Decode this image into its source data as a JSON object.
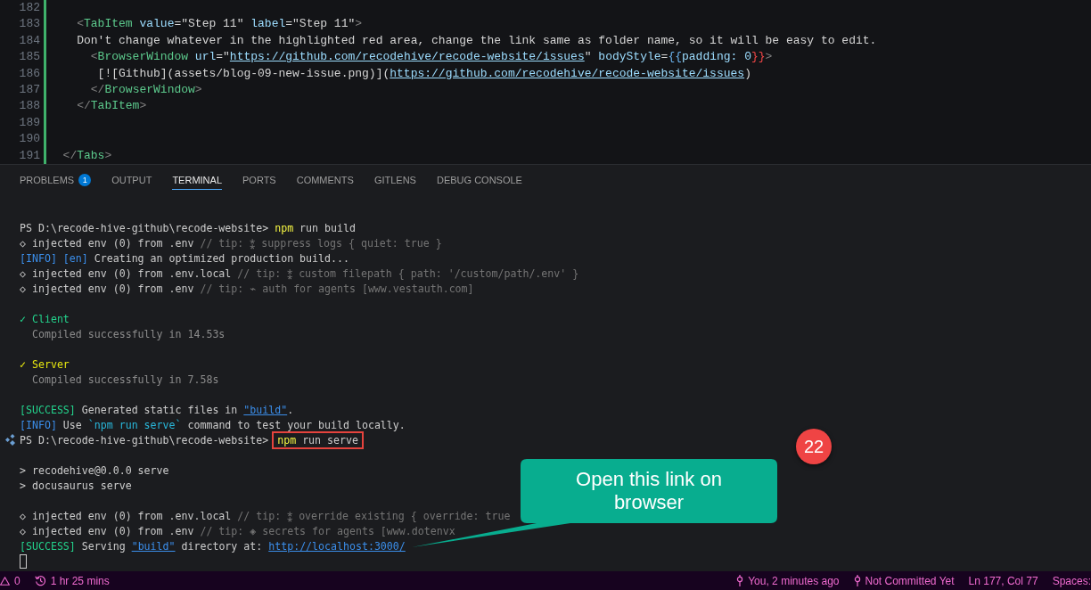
{
  "editor": {
    "lines": [
      {
        "number": "182",
        "changed": true
      },
      {
        "number": "183",
        "changed": true,
        "tokens": [
          {
            "text": "    <",
            "kind": "punct"
          },
          {
            "text": "TabItem",
            "kind": "tag"
          },
          {
            "text": " value",
            "kind": "attr"
          },
          {
            "text": "=\"Step 11\"",
            "kind": "text"
          },
          {
            "text": " label",
            "kind": "attr"
          },
          {
            "text": "=\"Step 11\"",
            "kind": "text"
          },
          {
            "text": ">",
            "kind": "punct"
          }
        ]
      },
      {
        "number": "184",
        "changed": true,
        "tokens": [
          {
            "text": "    Don't change whatever in the highlighted red area, change the link same as folder name, so it will be easy to edit.",
            "kind": "text"
          }
        ]
      },
      {
        "number": "185",
        "changed": true,
        "tokens": [
          {
            "text": "      <",
            "kind": "punct"
          },
          {
            "text": "BrowserWindow",
            "kind": "tag"
          },
          {
            "text": " url",
            "kind": "attr"
          },
          {
            "text": "=\"",
            "kind": "text"
          },
          {
            "text": "https://github.com/recodehive/recode-website/issues",
            "kind": "link"
          },
          {
            "text": "\"",
            "kind": "text"
          },
          {
            "text": " bodyStyle",
            "kind": "attr"
          },
          {
            "text": "=",
            "kind": "text"
          },
          {
            "text": "{{",
            "kind": "brace"
          },
          {
            "text": "padding: 0",
            "kind": "attr"
          },
          {
            "text": "}}",
            "kind": "error"
          },
          {
            "text": ">",
            "kind": "punct"
          }
        ]
      },
      {
        "number": "186",
        "changed": true,
        "tokens": [
          {
            "text": "       [![Github](assets/blog-09-new-issue.png)](",
            "kind": "text"
          },
          {
            "text": "https://github.com/recodehive/recode-website/issues",
            "kind": "link"
          },
          {
            "text": ")",
            "kind": "text"
          }
        ]
      },
      {
        "number": "187",
        "changed": true,
        "tokens": [
          {
            "text": "      </",
            "kind": "punct"
          },
          {
            "text": "BrowserWindow",
            "kind": "tag"
          },
          {
            "text": ">",
            "kind": "punct"
          }
        ]
      },
      {
        "number": "188",
        "changed": true,
        "tokens": [
          {
            "text": "    </",
            "kind": "punct"
          },
          {
            "text": "TabItem",
            "kind": "tag"
          },
          {
            "text": ">",
            "kind": "punct"
          }
        ]
      },
      {
        "number": "189",
        "changed": true
      },
      {
        "number": "190",
        "changed": true
      },
      {
        "number": "191",
        "changed": true,
        "tokens": [
          {
            "text": "  </",
            "kind": "punct"
          },
          {
            "text": "Tabs",
            "kind": "tag"
          },
          {
            "text": ">",
            "kind": "punct"
          }
        ]
      }
    ]
  },
  "panel": {
    "tabs": [
      {
        "label": "PROBLEMS",
        "selected": false,
        "badge": "1"
      },
      {
        "label": "OUTPUT",
        "selected": false
      },
      {
        "label": "TERMINAL",
        "selected": true
      },
      {
        "label": "PORTS",
        "selected": false
      },
      {
        "label": "COMMENTS",
        "selected": false
      },
      {
        "label": "GITLENS",
        "selected": false
      },
      {
        "label": "DEBUG CONSOLE",
        "selected": false
      }
    ],
    "terminal": {
      "lines": [
        {
          "kind": "prompt",
          "decorated": false,
          "segments": [
            {
              "text": "PS D:\\recode-hive-github\\recode-website> ",
              "kind": "plain"
            },
            {
              "text": "npm",
              "kind": "cmd"
            },
            {
              "text": " run build",
              "kind": "plain"
            }
          ]
        },
        {
          "kind": "output",
          "segments": [
            {
              "text": "◇ injected env (0) from .env",
              "kind": "plain"
            },
            {
              "text": " // tip: ⁑ suppress logs { quiet: true }",
              "kind": "dim"
            }
          ]
        },
        {
          "kind": "output",
          "segments": [
            {
              "text": "[INFO] [en]",
              "kind": "info"
            },
            {
              "text": " Creating an optimized production build...",
              "kind": "plain"
            }
          ]
        },
        {
          "kind": "output",
          "segments": [
            {
              "text": "◇ injected env (0) from .env.local",
              "kind": "plain"
            },
            {
              "text": " // tip: ⁑ custom filepath { path: '/custom/path/.env' }",
              "kind": "dim"
            }
          ]
        },
        {
          "kind": "output",
          "segments": [
            {
              "text": "◇ injected env (0) from .env",
              "kind": "plain"
            },
            {
              "text": " // tip: ⌁ auth for agents [www.vestauth.com]",
              "kind": "dim"
            }
          ]
        },
        {
          "kind": "blank"
        },
        {
          "kind": "output",
          "segments": [
            {
              "text": "✓ Client",
              "kind": "success"
            }
          ]
        },
        {
          "kind": "output",
          "segments": [
            {
              "text": "  Compiled successfully in 14.53s",
              "kind": "muted"
            }
          ]
        },
        {
          "kind": "blank"
        },
        {
          "kind": "output",
          "segments": [
            {
              "text": "✓ Server",
              "kind": "warn"
            }
          ]
        },
        {
          "kind": "output",
          "segments": [
            {
              "text": "  Compiled successfully in 7.58s",
              "kind": "muted"
            }
          ]
        },
        {
          "kind": "blank"
        },
        {
          "kind": "output",
          "segments": [
            {
              "text": "[SUCCESS]",
              "kind": "success"
            },
            {
              "text": " Generated static files in ",
              "kind": "plain"
            },
            {
              "text": "\"build\"",
              "kind": "link"
            },
            {
              "text": ".",
              "kind": "plain"
            }
          ]
        },
        {
          "kind": "output",
          "segments": [
            {
              "text": "[INFO]",
              "kind": "info"
            },
            {
              "text": " Use ",
              "kind": "plain"
            },
            {
              "text": "`npm run serve`",
              "kind": "code"
            },
            {
              "text": " command to test your build locally.",
              "kind": "plain"
            }
          ]
        },
        {
          "kind": "prompt",
          "decorated": true,
          "segments": [
            {
              "text": "PS D:\\recode-hive-github\\recode-website>",
              "kind": "plain"
            },
            {
              "kind": "box",
              "parts": [
                {
                  "text": "npm",
                  "kind": "cmd"
                },
                {
                  "text": " run serve",
                  "kind": "plain"
                }
              ]
            }
          ]
        },
        {
          "kind": "blank"
        },
        {
          "kind": "output",
          "segments": [
            {
              "text": "> recodehive@0.0.0 serve",
              "kind": "plain"
            }
          ]
        },
        {
          "kind": "output",
          "segments": [
            {
              "text": "> docusaurus serve",
              "kind": "plain"
            }
          ]
        },
        {
          "kind": "blank"
        },
        {
          "kind": "output",
          "segments": [
            {
              "text": "◇ injected env (0) from .env.local",
              "kind": "plain"
            },
            {
              "text": " // tip: ⁑ override existing { override: true",
              "kind": "dim"
            }
          ]
        },
        {
          "kind": "output",
          "segments": [
            {
              "text": "◇ injected env (0) from .env",
              "kind": "plain"
            },
            {
              "text": " // tip: ◈ secrets for agents [www.dotenvx",
              "kind": "dim"
            }
          ]
        },
        {
          "kind": "output",
          "segments": [
            {
              "text": "[SUCCESS]",
              "kind": "success"
            },
            {
              "text": " Serving ",
              "kind": "plain"
            },
            {
              "text": "\"build\"",
              "kind": "link"
            },
            {
              "text": " directory at: ",
              "kind": "plain"
            },
            {
              "text": "http://localhost:3000/",
              "kind": "link"
            }
          ]
        },
        {
          "kind": "cursor"
        }
      ]
    }
  },
  "status_bar": {
    "warnings": "0",
    "session_time": "1 hr 25 mins",
    "blame": "You, 2 minutes ago",
    "commit_status": "Not Committed Yet",
    "cursor_position": "Ln 177, Col 77",
    "indentation": "Spaces:"
  },
  "annotations": {
    "step_badge": "22",
    "callout": "Open this link on browser"
  }
}
